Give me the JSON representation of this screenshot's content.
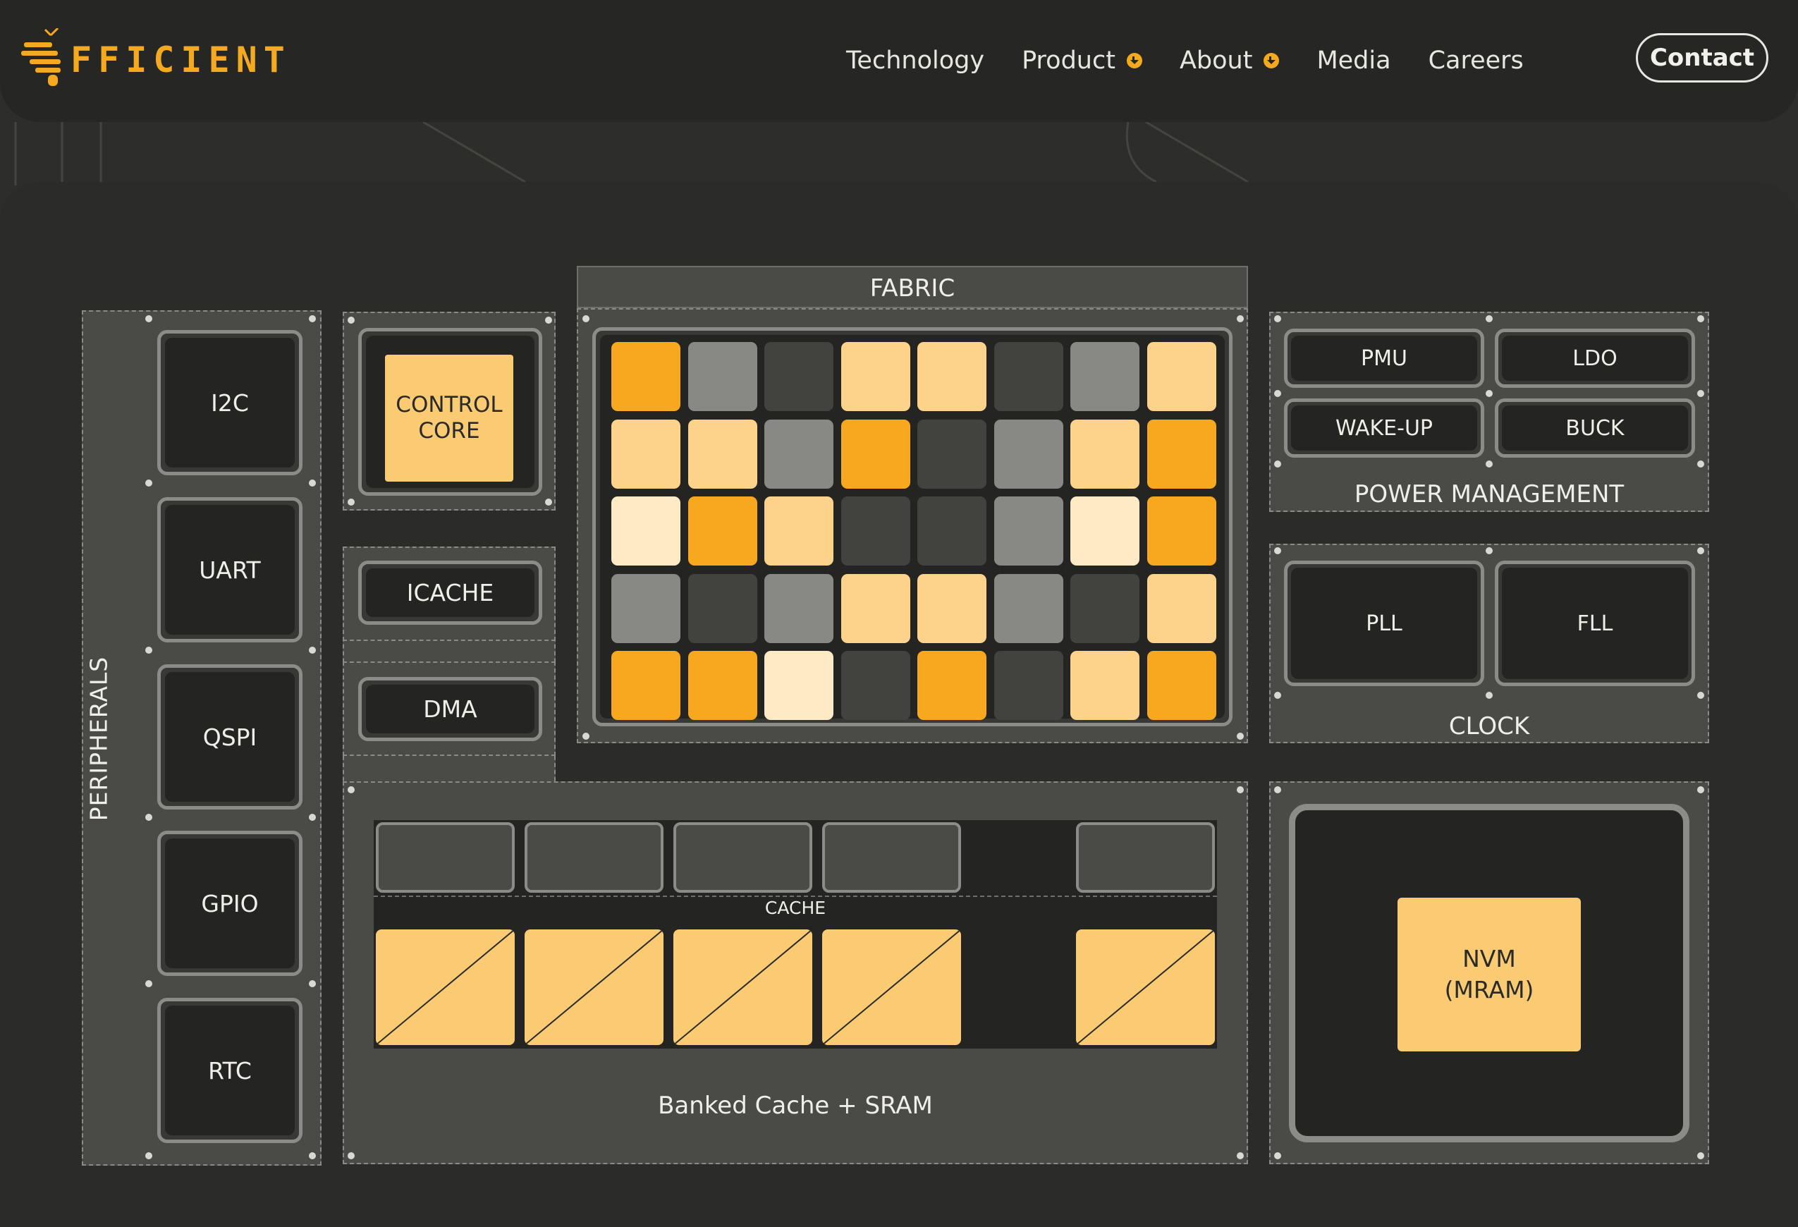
{
  "header": {
    "logo_text": "FFICIENT",
    "nav": [
      {
        "label": "Technology",
        "dropdown": false
      },
      {
        "label": "Product",
        "dropdown": true
      },
      {
        "label": "About",
        "dropdown": true
      },
      {
        "label": "Media",
        "dropdown": false
      },
      {
        "label": "Careers",
        "dropdown": false
      }
    ],
    "contact_label": "Contact"
  },
  "diagram": {
    "peripherals": {
      "title": "PERIPHERALS",
      "items": [
        "I2C",
        "UART",
        "QSPI",
        "GPIO",
        "RTC"
      ]
    },
    "control_core": "CONTROL\nCORE",
    "icache": "ICACHE",
    "dma": "DMA",
    "fabric": {
      "title": "FABRIC",
      "grid": [
        [
          "orange",
          "gray",
          "dark",
          "light",
          "light",
          "dark",
          "gray",
          "light"
        ],
        [
          "light",
          "light",
          "gray",
          "orange",
          "dark",
          "gray",
          "light",
          "orange"
        ],
        [
          "cream",
          "orange",
          "light",
          "dark",
          "dark",
          "gray",
          "cream",
          "orange"
        ],
        [
          "gray",
          "dark",
          "gray",
          "light",
          "light",
          "gray",
          "dark",
          "light"
        ],
        [
          "orange",
          "orange",
          "cream",
          "dark",
          "orange",
          "dark",
          "light",
          "orange"
        ]
      ]
    },
    "power_management": {
      "title": "POWER MANAGEMENT",
      "items": [
        "PMU",
        "LDO",
        "WAKE-UP",
        "BUCK"
      ]
    },
    "clock": {
      "title": "CLOCK",
      "items": [
        "PLL",
        "FLL"
      ]
    },
    "memory": {
      "cache_label": "CACHE",
      "title": "Banked Cache + SRAM"
    },
    "nvm": "NVM\n(MRAM)"
  },
  "colors": {
    "accent": "#f4a91f",
    "orange": "#f7a81e",
    "light": "#fdd38c",
    "cream": "#feebc6",
    "gray": "#888884",
    "dark": "#42423f",
    "gold": "#fbcb74"
  }
}
